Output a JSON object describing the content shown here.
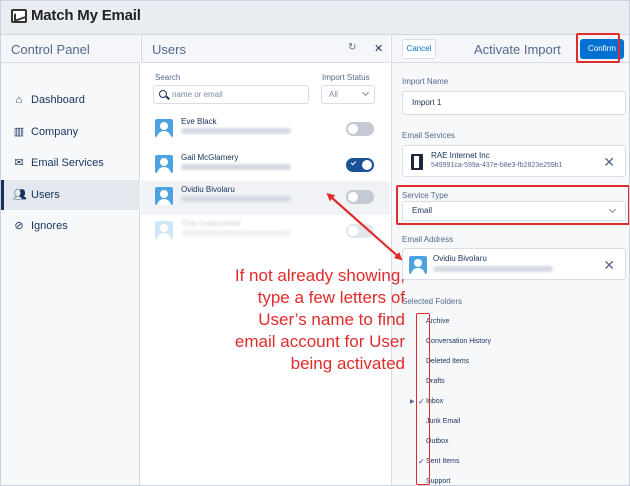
{
  "app": {
    "title": "Match My Email"
  },
  "headers": {
    "control_panel": "Control Panel",
    "users": "Users",
    "activate_import": "Activate Import",
    "refresh_icon": "↻",
    "close_icon": "✕"
  },
  "nav": {
    "items": [
      {
        "label": "Dashboard",
        "icon": "home-icon",
        "active": false
      },
      {
        "label": "Company",
        "icon": "building-icon",
        "active": false
      },
      {
        "label": "Email Services",
        "icon": "envelope-icon",
        "active": false
      },
      {
        "label": "Users",
        "icon": "users-icon",
        "active": true
      },
      {
        "label": "Ignores",
        "icon": "block-icon",
        "active": false
      }
    ]
  },
  "users_panel": {
    "search_label": "Search",
    "search_placeholder": "name or email",
    "status_label": "Import Status",
    "status_value": "All",
    "rows": [
      {
        "name": "Eve Black",
        "toggle": "off"
      },
      {
        "name": "Gail McGlamery",
        "toggle": "on"
      },
      {
        "name": "Ovidiu Bivolaru",
        "toggle": "off"
      },
      {
        "name": "Tina Goldschmitt",
        "toggle": "off"
      }
    ]
  },
  "import_panel": {
    "cancel_label": "Cancel",
    "confirm_label": "Confirm",
    "import_name_label": "Import Name",
    "import_name_value": "Import 1",
    "email_services_label": "Email Services",
    "service_name": "RAE Internet Inc",
    "service_id": "549991ca-599a-437e-b8e3-fb2823e259b1",
    "service_type_label": "Service Type",
    "service_type_value": "Email",
    "email_address_label": "Email Address",
    "email_user": "Ovidiu Bivolaru",
    "selected_folders_label": "Selected Folders",
    "folders": [
      {
        "name": "Archive",
        "checked": false,
        "expandable": false
      },
      {
        "name": "Conversation History",
        "checked": false,
        "expandable": false
      },
      {
        "name": "Deleted Items",
        "checked": false,
        "expandable": false
      },
      {
        "name": "Drafts",
        "checked": false,
        "expandable": false
      },
      {
        "name": "Inbox",
        "checked": true,
        "expandable": true
      },
      {
        "name": "Junk Email",
        "checked": false,
        "expandable": false
      },
      {
        "name": "Outbox",
        "checked": false,
        "expandable": false
      },
      {
        "name": "Sent Items",
        "checked": true,
        "expandable": false
      },
      {
        "name": "Support",
        "checked": false,
        "expandable": false
      }
    ]
  },
  "annotation": {
    "lines": [
      "If not already showing,",
      "type a few letters of",
      "User’s name to find",
      "email account for User",
      "being activated"
    ],
    "color": "#e02b2b"
  },
  "colors": {
    "accent": "#0070d2",
    "toggle_on": "#1b5297",
    "avatar": "#4ca3e0",
    "navy": "#16325c"
  }
}
